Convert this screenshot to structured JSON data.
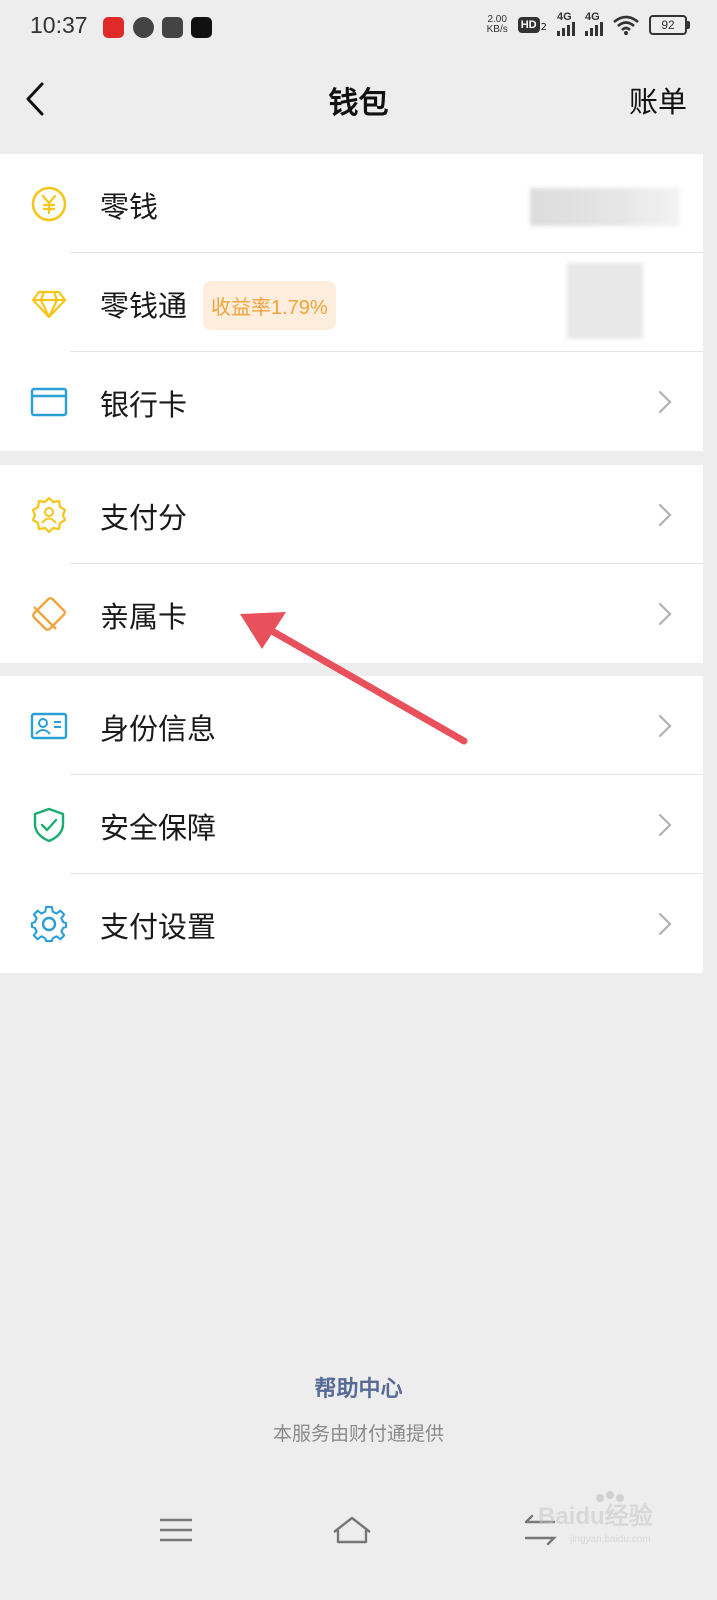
{
  "status_bar": {
    "time": "10:37",
    "net_speed_value": "2.00",
    "net_speed_unit": "KB/s",
    "hd_label": "HD",
    "hd_sub": "2",
    "sim1_label": "4G",
    "sim2_label": "4G",
    "battery": "92"
  },
  "nav": {
    "title": "钱包",
    "right_action": "账单"
  },
  "groups": [
    {
      "items": [
        {
          "label": "零钱",
          "icon": "yuan-coin-icon",
          "color": "#f5c518"
        },
        {
          "label": "零钱通",
          "icon": "diamond-icon",
          "color": "#f5c518",
          "badge": "收益率1.79%"
        },
        {
          "label": "银行卡",
          "icon": "bank-card-icon",
          "color": "#2a9fd6"
        }
      ]
    },
    {
      "items": [
        {
          "label": "支付分",
          "icon": "pay-score-badge-icon",
          "color": "#f5c518"
        },
        {
          "label": "亲属卡",
          "icon": "family-card-icon",
          "color": "#f0a43c"
        }
      ]
    },
    {
      "items": [
        {
          "label": "身份信息",
          "icon": "id-card-icon",
          "color": "#2a9fd6"
        },
        {
          "label": "安全保障",
          "icon": "shield-check-icon",
          "color": "#1aad72"
        },
        {
          "label": "支付设置",
          "icon": "gear-icon",
          "color": "#2a9fd6"
        }
      ]
    }
  ],
  "footer": {
    "help_center": "帮助中心",
    "provider": "本服务由财付通提供"
  },
  "watermark": {
    "text": "Baidu经验",
    "url_text": "jingyan.baidu.com"
  },
  "colors": {
    "background": "#ededed",
    "link": "#576b95",
    "annotation_arrow": "#e8505b"
  }
}
